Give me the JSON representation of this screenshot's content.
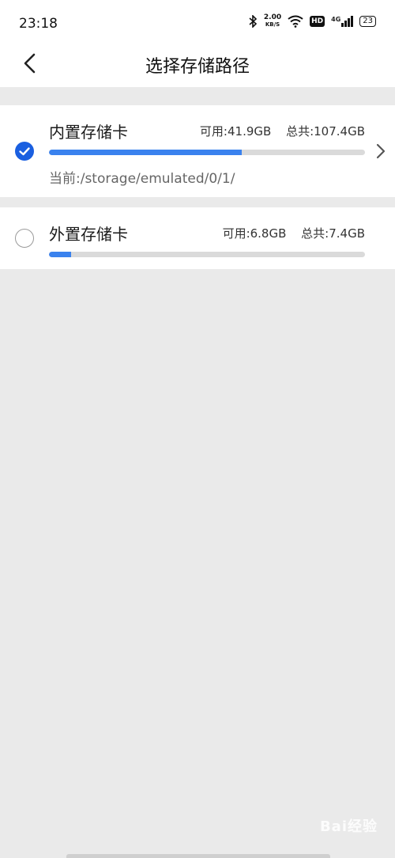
{
  "status_bar": {
    "time": "23:18",
    "net_speed_value": "2.00",
    "net_speed_unit": "KB/S",
    "hd_label": "HD",
    "signal_label": "4G",
    "battery": "23"
  },
  "header": {
    "title": "选择存储路径"
  },
  "storage": {
    "internal": {
      "label": "内置存储卡",
      "available": "可用:41.9GB",
      "total": "总共:107.4GB",
      "used_fraction": 0.61,
      "path": "当前:/storage/emulated/0/1/",
      "selected": true
    },
    "external": {
      "label": "外置存储卡",
      "available": "可用:6.8GB",
      "total": "总共:7.4GB",
      "used_fraction": 0.07,
      "selected": false
    }
  },
  "watermark": "Bai经验",
  "colors": {
    "accent": "#1a5fe0",
    "bar_fill": "#3a82ee",
    "bar_track": "#dadada",
    "background": "#eaeaea"
  }
}
